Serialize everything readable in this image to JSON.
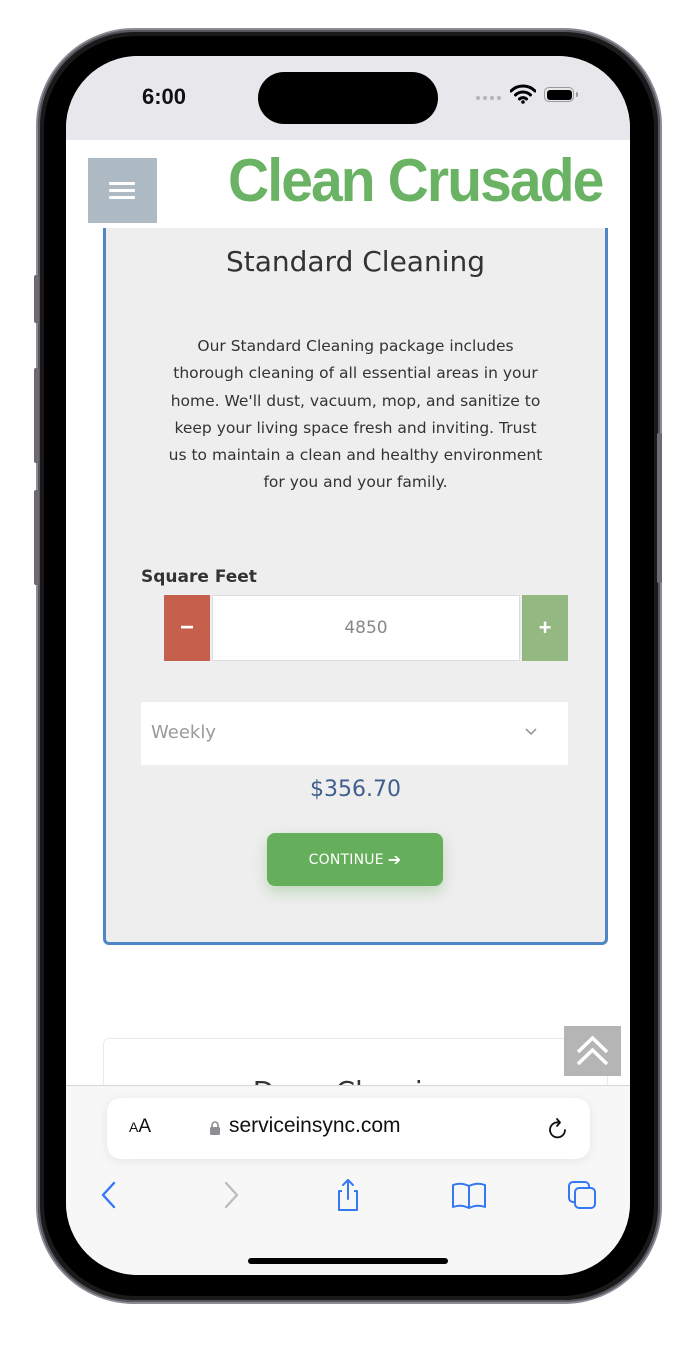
{
  "status_bar": {
    "time": "6:00"
  },
  "site": {
    "logo_text": "Clean Crusade",
    "menu_icon": "hamburger-icon",
    "brand_color": "#6ab364"
  },
  "standard_card": {
    "title": "Standard Cleaning",
    "description": "Our Standard Cleaning package includes thorough cleaning of all essential areas in your home. We'll dust, vacuum, mop, and sanitize to keep your living space fresh and inviting. Trust us to maintain a clean and healthy environment for you and your family.",
    "square_feet_label": "Square Feet",
    "stepper": {
      "minus_label": "−",
      "plus_label": "+",
      "value": "4850"
    },
    "frequency": {
      "selected": "Weekly"
    },
    "price": "$356.70",
    "continue_label": "CONTINUE",
    "continue_icon": "arrow-right-icon",
    "border_color": "#4f86c6"
  },
  "deep_card": {
    "title": "Deep Cleaning"
  },
  "scroll_top_icon": "double-chevron-up-icon",
  "browser": {
    "text_size_label": "AA",
    "url": "serviceinsync.com",
    "nav": {
      "back": "back-icon",
      "forward": "forward-icon",
      "share": "share-icon",
      "bookmarks": "bookmarks-icon",
      "tabs": "tabs-icon"
    },
    "accent_color": "#3478f6"
  }
}
